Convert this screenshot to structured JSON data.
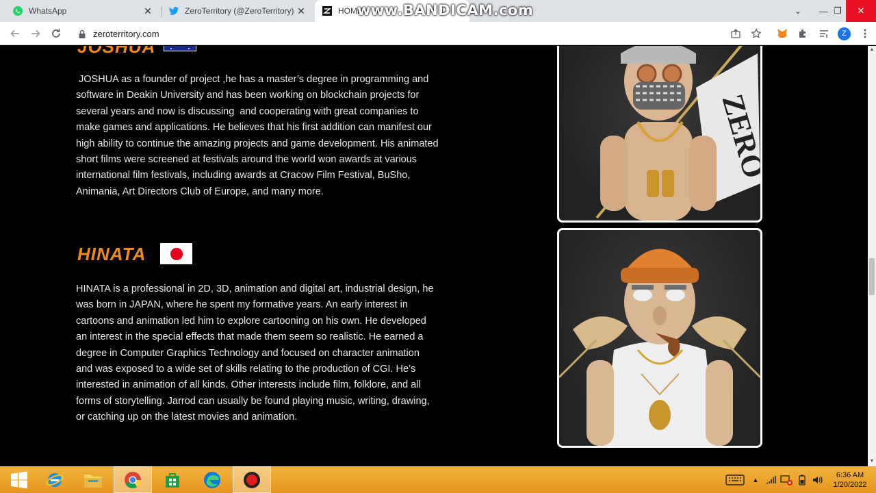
{
  "browser": {
    "tabs": [
      {
        "title": "WhatsApp",
        "active": false
      },
      {
        "title": "ZeroTerritory (@ZeroTerritory) / T",
        "active": false
      },
      {
        "title": "HOME",
        "active": true
      }
    ],
    "url": "zeroterritory.com",
    "profile_initial": "Z"
  },
  "watermark": "www.BANDICAM.com",
  "team": [
    {
      "name": "JOSHUA",
      "flag": "australia",
      "bio": " JOSHUA as a founder of project ,he has a master’s degree in programming and software in Deakin University and has been working on blockchain projects for several years and now is discussing  and cooperating with great companies to make games and applications. He believes that his first addition can manifest our high ability to continue the amazing projects and game development. His animated short films were screened at festivals around the world won awards at various international film festivals, including awards at Cracow Film Festival, BuSho, Animania, Art Directors Club of Europe, and many more.",
      "card_text": "ZERO"
    },
    {
      "name": "HINATA",
      "flag": "japan",
      "bio": "HINATA is a professional in 2D, 3D, animation and digital art, industrial design, he was born in JAPAN, where he spent my formative years. An early interest in cartoons and animation led him to explore cartooning on his own. He developed an interest in the special effects that made them seem so realistic. He earned a degree in Computer Graphics Technology and focused on character animation and was exposed to a wide set of skills relating to the production of CGI. He’s interested in animation of all kinds. Other interests include film, folklore, and all forms of storytelling. Jarrod can usually be found playing music, writing, drawing, or catching up on the latest movies and animation."
    }
  ],
  "colors": {
    "accent_name": "#f08a1c",
    "page_bg": "#000000",
    "taskbar": "#e5951f"
  },
  "taskbar": {
    "apps": [
      "start-icon",
      "internet-explorer-icon",
      "file-explorer-icon",
      "chrome-icon",
      "store-icon",
      "edge-icon",
      "bandicam-record-icon"
    ],
    "clock": {
      "time": "6:36 AM",
      "date": "1/20/2022"
    }
  }
}
